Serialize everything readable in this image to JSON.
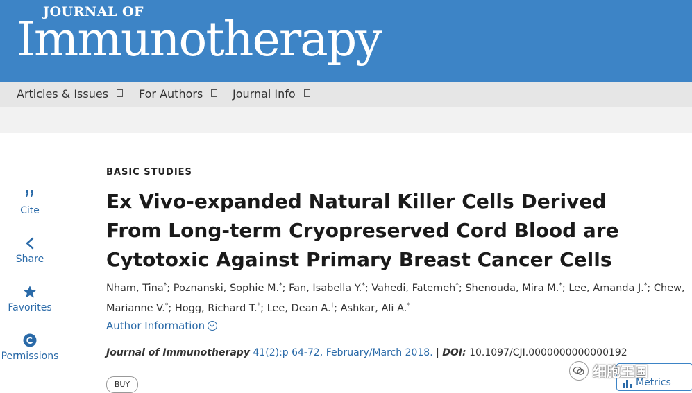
{
  "header": {
    "journal_small": "JOURNAL OF",
    "journal_big": "Immunotherapy",
    "background_color": "#3d84c6"
  },
  "nav": {
    "items": [
      {
        "label": "Articles & Issues"
      },
      {
        "label": "For Authors"
      },
      {
        "label": "Journal Info"
      }
    ]
  },
  "sidebar": {
    "items": [
      {
        "label": "Cite",
        "icon": "quote-icon"
      },
      {
        "label": "Share",
        "icon": "share-icon"
      },
      {
        "label": "Favorites",
        "icon": "star-icon"
      },
      {
        "label": "Permissions",
        "icon": "copyright-icon"
      }
    ]
  },
  "article": {
    "section": "BASIC STUDIES",
    "title": "Ex Vivo-expanded Natural Killer Cells Derived From Long-term Cryopreserved Cord Blood are Cytotoxic Against Primary Breast Cancer Cells",
    "authors": [
      {
        "name": "Nham, Tina",
        "mark": "*"
      },
      {
        "name": "Poznanski, Sophie M.",
        "mark": "*"
      },
      {
        "name": "Fan, Isabella Y.",
        "mark": "*"
      },
      {
        "name": "Vahedi, Fatemeh",
        "mark": "*"
      },
      {
        "name": "Shenouda, Mira M.",
        "mark": "*"
      },
      {
        "name": "Lee, Amanda J.",
        "mark": "*"
      },
      {
        "name": "Chew, Marianne V.",
        "mark": "*"
      },
      {
        "name": "Hogg, Richard T.",
        "mark": "*"
      },
      {
        "name": "Lee, Dean A.",
        "mark": "†"
      },
      {
        "name": "Ashkar, Ali A.",
        "mark": "*"
      }
    ],
    "author_info_label": "Author Information",
    "citation": {
      "journal": "Journal of Immunotherapy",
      "volume_link": "41(2):p 64-72, February/March 2018.",
      "separator": "|",
      "doi_label": "DOI:",
      "doi": "10.1097/CJI.0000000000000192"
    },
    "buy_label": "BUY",
    "metrics_label": "Metrics"
  },
  "watermark": {
    "text": "细胞王国"
  },
  "colors": {
    "link": "#2a6aa8",
    "nav_bg": "#e6e6e6"
  }
}
